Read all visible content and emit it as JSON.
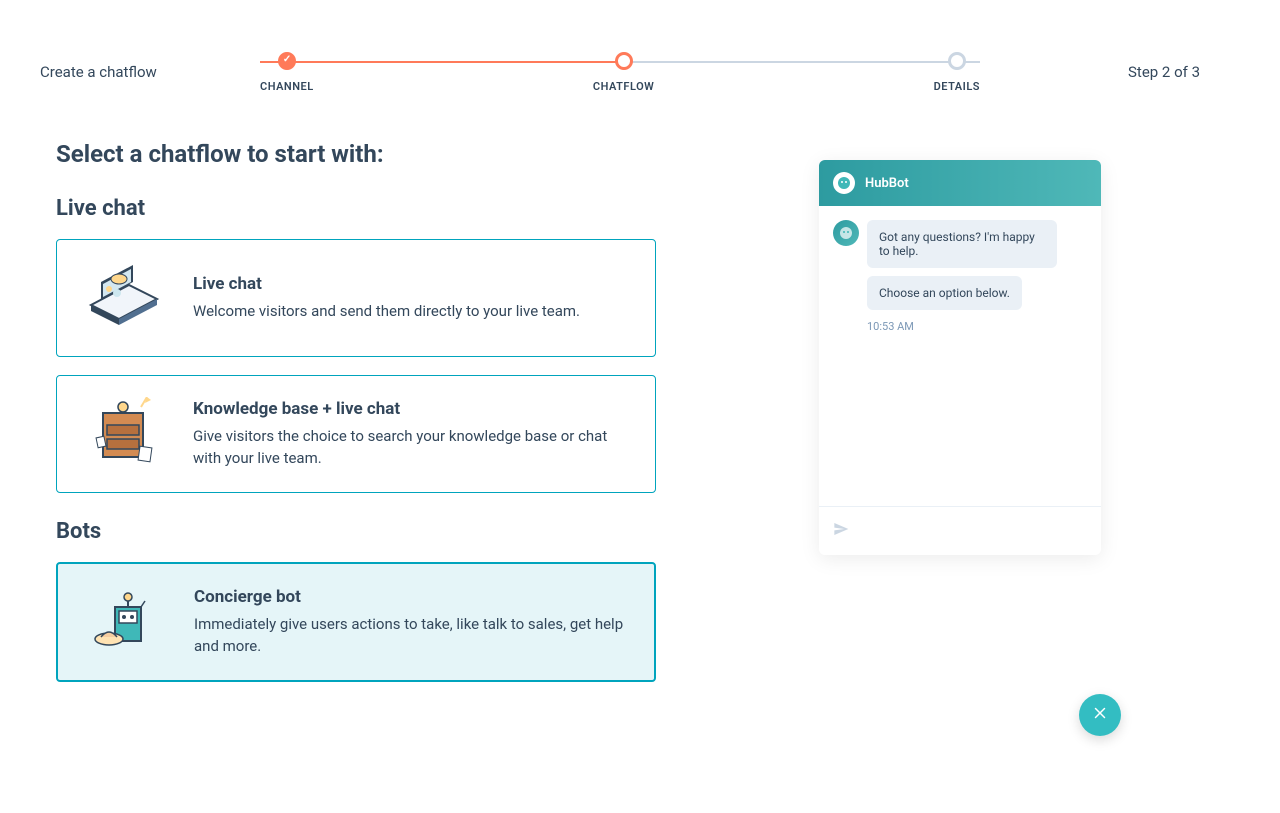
{
  "header": {
    "title": "Create a chatflow",
    "steps": [
      {
        "label": "CHANNEL",
        "state": "done"
      },
      {
        "label": "CHATFLOW",
        "state": "active"
      },
      {
        "label": "DETAILS",
        "state": "idle"
      }
    ],
    "step_counter": "Step 2 of 3"
  },
  "page_title": "Select a chatflow to start with:",
  "sections": {
    "live_chat": {
      "title": "Live chat",
      "cards": [
        {
          "id": "live-chat",
          "title": "Live chat",
          "desc": "Welcome visitors and send them directly to your live team.",
          "selected": false
        },
        {
          "id": "kb-live-chat",
          "title": "Knowledge base + live chat",
          "desc": "Give visitors the choice to search your knowledge base or chat with your live team.",
          "selected": false
        }
      ]
    },
    "bots": {
      "title": "Bots",
      "cards": [
        {
          "id": "concierge-bot",
          "title": "Concierge bot",
          "desc": "Immediately give users actions to take, like talk to sales, get help and more.",
          "selected": true
        }
      ]
    }
  },
  "preview": {
    "bot_name": "HubBot",
    "messages": [
      "Got any questions? I'm happy to help.",
      "Choose an option below."
    ],
    "timestamp": "10:53 AM"
  }
}
